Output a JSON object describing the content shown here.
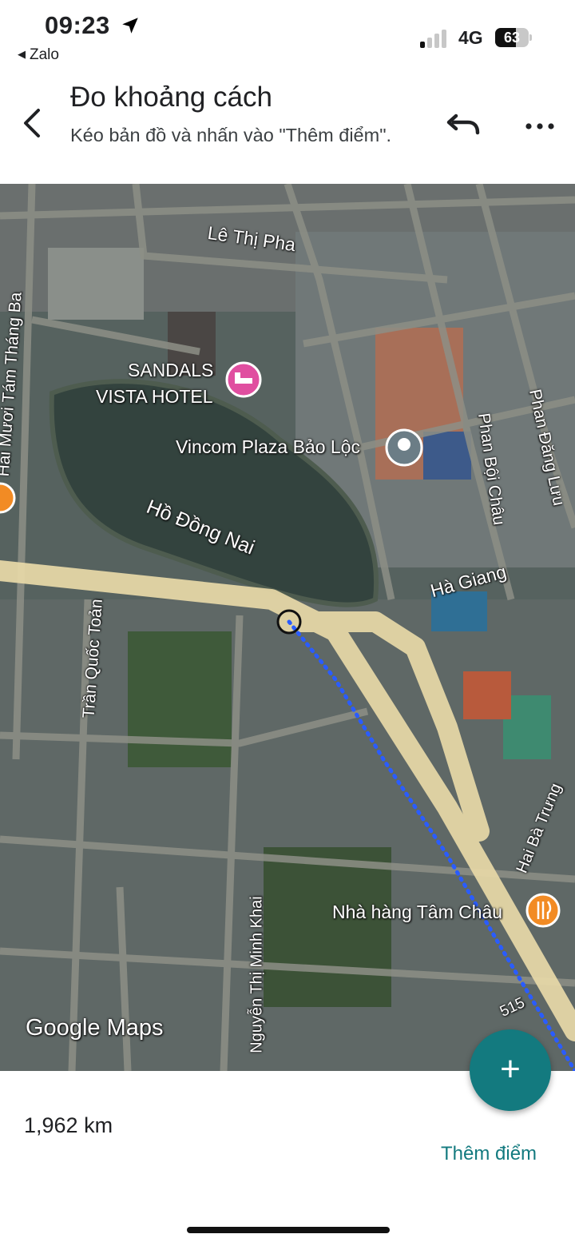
{
  "status_bar": {
    "time": "09:23",
    "back_app": "Zalo",
    "network": "4G",
    "battery": "63",
    "battery_level_percent": 63,
    "icons": [
      "location-arrow-icon",
      "signal-icon",
      "battery-icon"
    ]
  },
  "header": {
    "title": "Đo khoảng cách",
    "subtitle": "Kéo bản đồ và nhấn vào \"Thêm điểm\".",
    "icons": [
      "back-arrow-icon",
      "undo-icon",
      "more-icon"
    ]
  },
  "map": {
    "labels": {
      "le_thi_pha": "Lê Thị Pha",
      "hai_muoi_tam_thang_ba": "Hai Mươi Tám Tháng Ba",
      "sandals_line1": "SANDALS",
      "sandals_line2": "VISTA HOTEL",
      "vincom": "Vincom Plaza Bảo Lộc",
      "lake": "Hồ Đồng Nai",
      "phan_boi_chau": "Phan Bội Châu",
      "phan_dang_luu": "Phan Đăng Lưu",
      "ha_giang": "Hà Giang",
      "tran_quoc_toan": "Trần Quốc Toản",
      "hai_ba_trung": "Hai Bà Trưng",
      "nha_hang": "Nhà hàng Tâm Châu",
      "nguyen_thi_minh_khai": "Nguyễn Thị Minh Khai",
      "route_515": "515"
    },
    "watermark": "Google Maps",
    "colors": {
      "route": "#2a5cff",
      "road": "#e8d9a8",
      "hotel_pin": "#e04ea0",
      "restaurant_pin": "#f28b24"
    }
  },
  "add_button": {
    "symbol": "+"
  },
  "footer": {
    "distance": "1,962 km",
    "add_point_label": "Thêm điểm",
    "accent": "#137a7f"
  }
}
